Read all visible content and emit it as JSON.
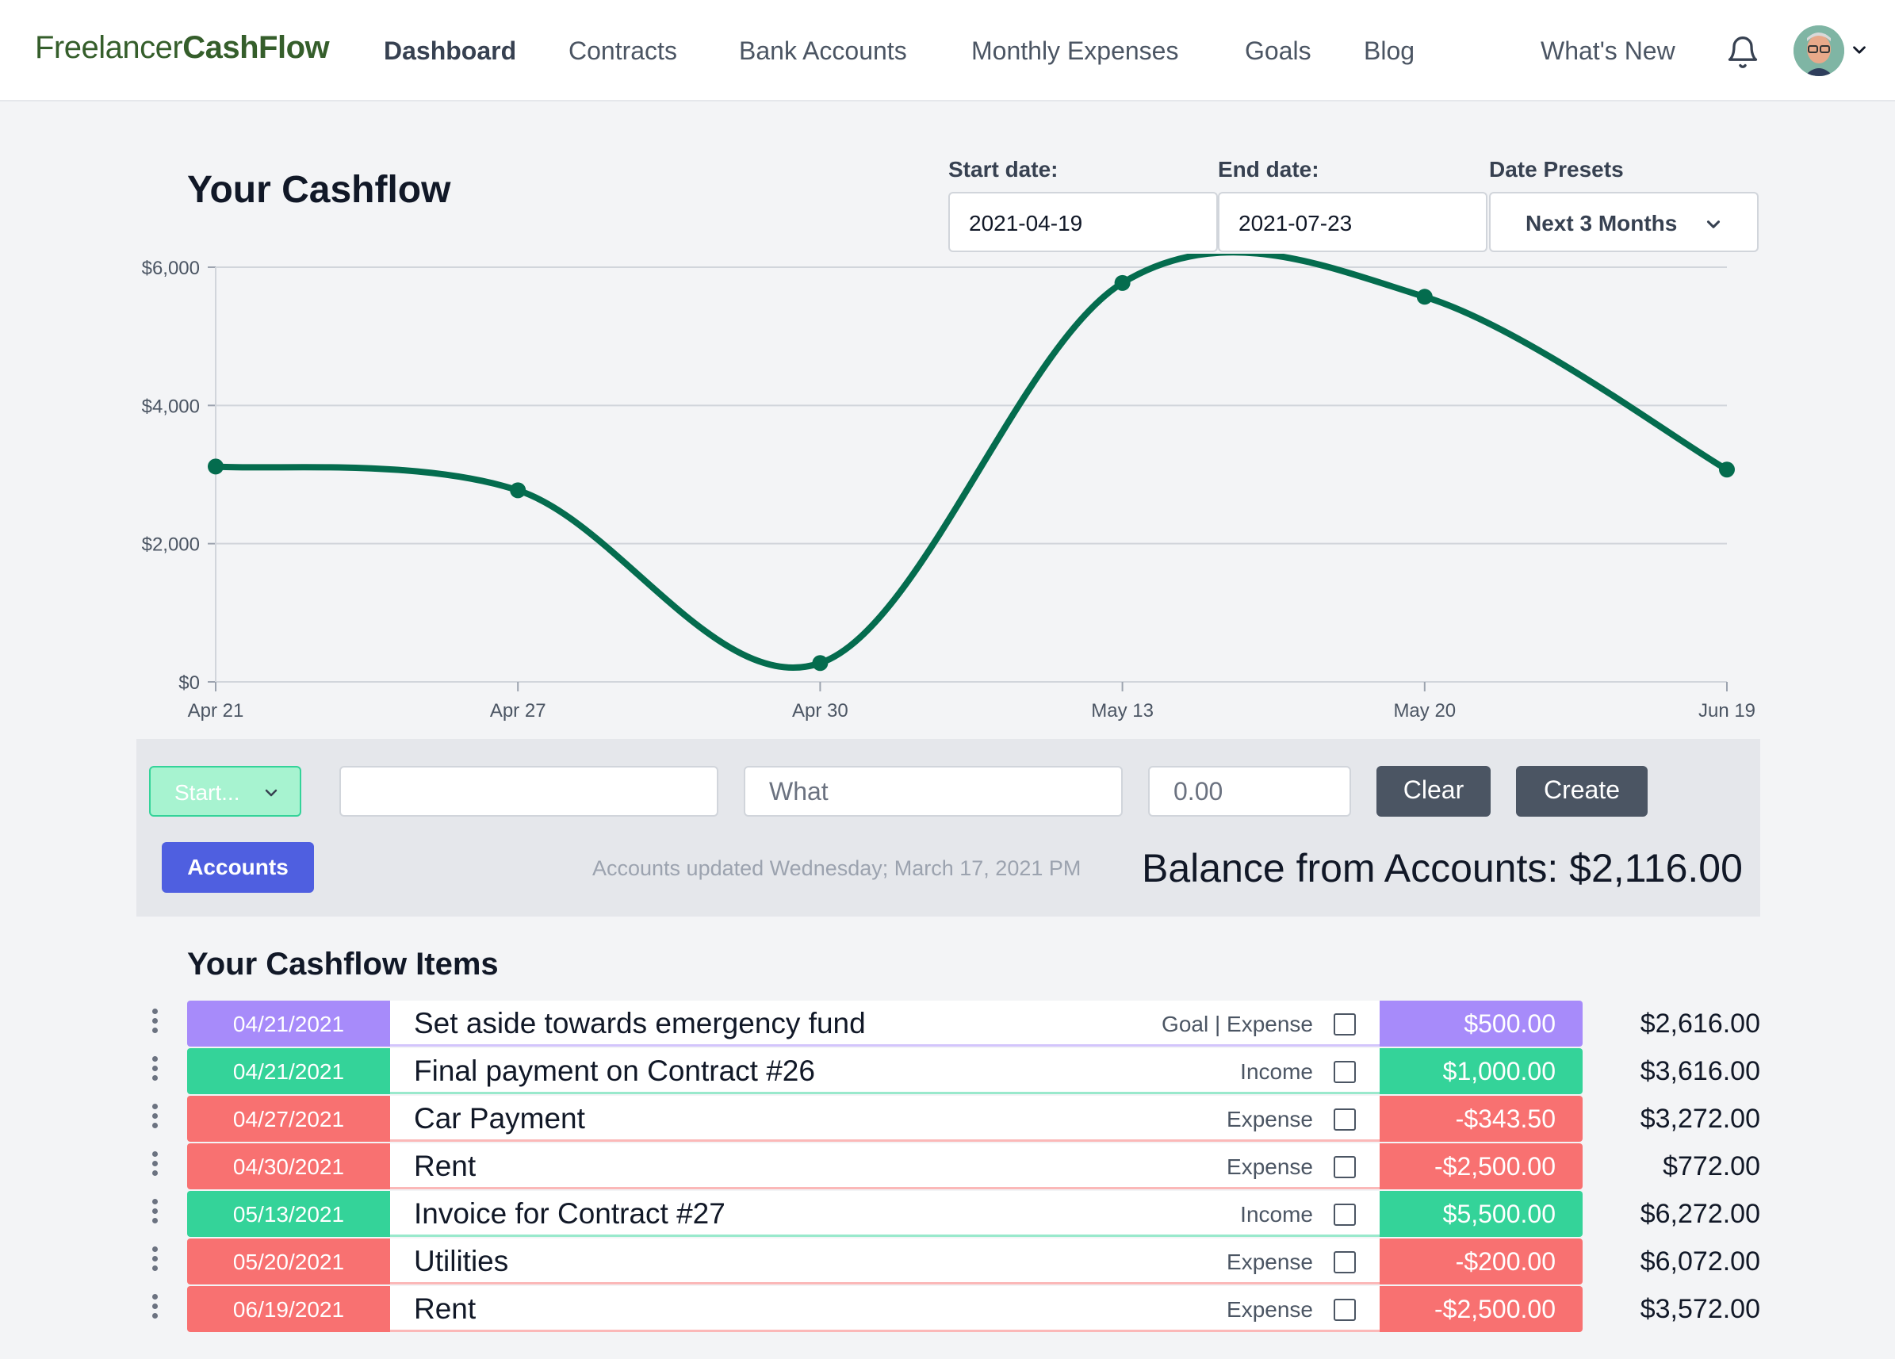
{
  "brand": {
    "part1": "Freelancer",
    "part2": "CashFlow"
  },
  "nav": {
    "links": [
      "Dashboard",
      "Contracts",
      "Bank Accounts",
      "Monthly Expenses",
      "Goals",
      "Blog"
    ],
    "whats_new": "What's New"
  },
  "icons": {
    "bell": "bell-icon",
    "avatar": "user-avatar",
    "chevron": "chevron-down-icon",
    "drag": "drag-handle-icon"
  },
  "cashflow": {
    "title": "Your Cashflow",
    "start_label": "Start date:",
    "start_value": "2021-04-19",
    "end_label": "End date:",
    "end_value": "2021-07-23",
    "preset_label": "Date Presets",
    "preset_value": "Next 3 Months"
  },
  "chart_data": {
    "type": "line",
    "title": "",
    "xlabel": "",
    "ylabel": "",
    "x": [
      "Apr 21",
      "Apr 27",
      "Apr 30",
      "May 13",
      "May 20",
      "Jun 19"
    ],
    "y_ticks": [
      "$0",
      "$2,000",
      "$4,000",
      "$6,000"
    ],
    "ylim": [
      0,
      6000
    ],
    "grid": true,
    "series": [
      {
        "values": [
          3116,
          2772,
          272,
          5772,
          5572,
          3072
        ],
        "color": "#046c4e"
      }
    ]
  },
  "form": {
    "start_select": "Start...",
    "first_input_value": "",
    "what_placeholder": "What",
    "amount_placeholder": "0.00",
    "clear_label": "Clear",
    "create_label": "Create",
    "accounts_label": "Accounts",
    "updated_text": "Accounts updated Wednesday; March 17, 2021 PM",
    "balance_text": "Balance from Accounts: $2,116.00"
  },
  "items_title": "Your Cashflow Items",
  "items": [
    {
      "date": "04/21/2021",
      "desc": "Set aside towards emergency fund",
      "type": "Goal | Expense",
      "amount": "$500.00",
      "balance": "$2,616.00",
      "kind": "goal"
    },
    {
      "date": "04/21/2021",
      "desc": "Final payment on Contract #26",
      "type": "Income",
      "amount": "$1,000.00",
      "balance": "$3,616.00",
      "kind": "income"
    },
    {
      "date": "04/27/2021",
      "desc": "Car Payment",
      "type": "Expense",
      "amount": "-$343.50",
      "balance": "$3,272.00",
      "kind": "expense"
    },
    {
      "date": "04/30/2021",
      "desc": "Rent",
      "type": "Expense",
      "amount": "-$2,500.00",
      "balance": "$772.00",
      "kind": "expense"
    },
    {
      "date": "05/13/2021",
      "desc": "Invoice for Contract #27",
      "type": "Income",
      "amount": "$5,500.00",
      "balance": "$6,272.00",
      "kind": "income"
    },
    {
      "date": "05/20/2021",
      "desc": "Utilities",
      "type": "Expense",
      "amount": "-$200.00",
      "balance": "$6,072.00",
      "kind": "expense"
    },
    {
      "date": "06/19/2021",
      "desc": "Rent",
      "type": "Expense",
      "amount": "-$2,500.00",
      "balance": "$3,572.00",
      "kind": "expense"
    }
  ],
  "colors": {
    "goal": "#a78bfa",
    "income": "#34d399",
    "expense": "#f87171",
    "line": "#046c4e",
    "brand": "#355e2b",
    "accounts_button": "#4f5fe0"
  }
}
